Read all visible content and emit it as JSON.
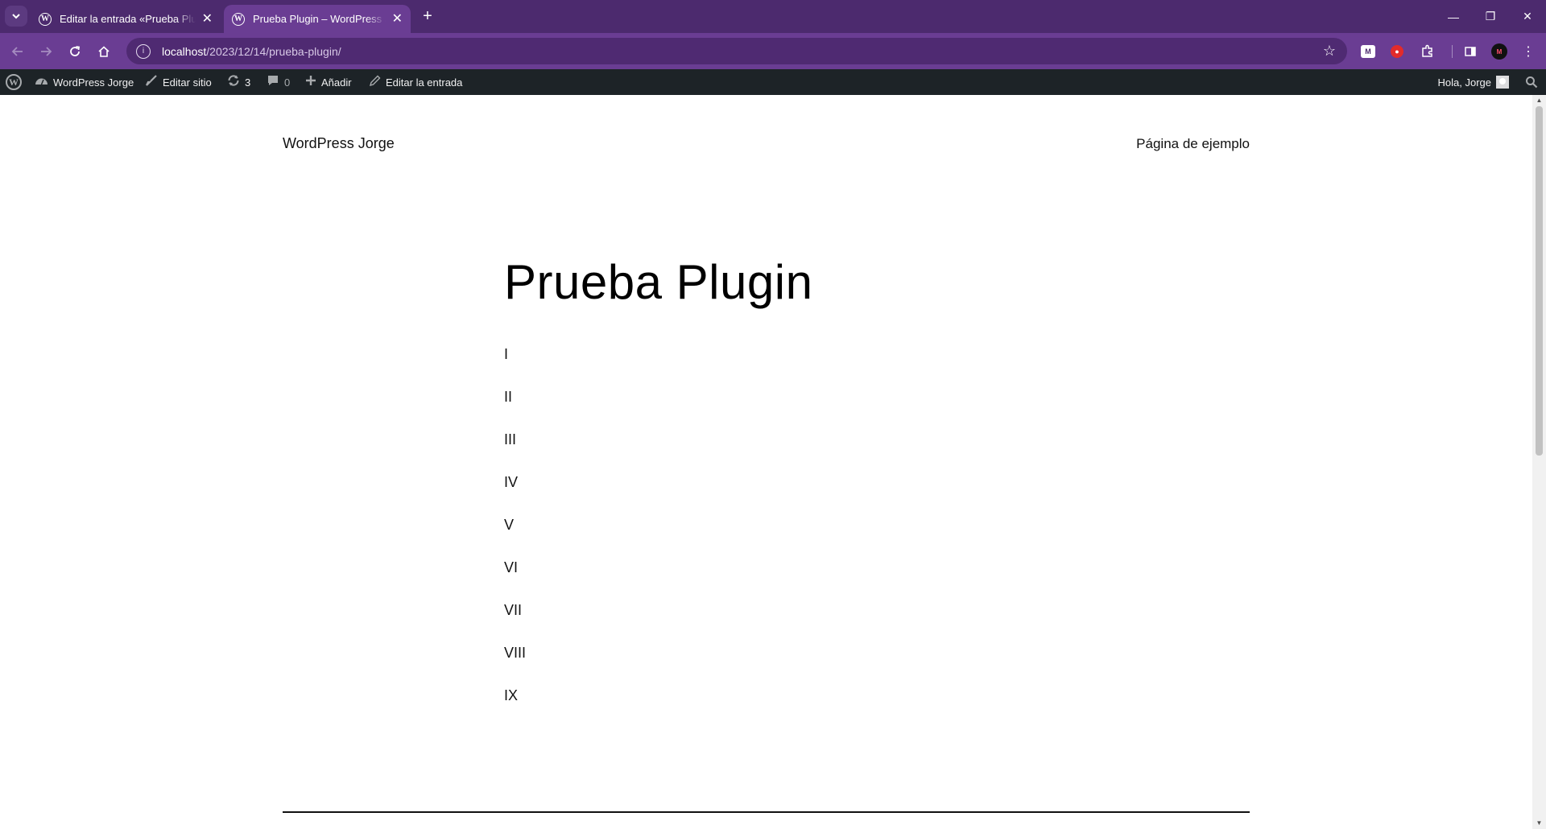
{
  "browser": {
    "tabs": [
      {
        "title": "Editar la entrada «Prueba Plugin",
        "active": false
      },
      {
        "title": "Prueba Plugin – WordPress Jorge",
        "active": true
      }
    ],
    "url_host": "localhost",
    "url_path": "/2023/12/14/prueba-plugin/",
    "theme_colors": {
      "tabstrip": "#4c2a6e",
      "toolbar": "#6a3d93",
      "omnibox": "#4f2a72"
    }
  },
  "adminbar": {
    "site_name": "WordPress Jorge",
    "edit_site": "Editar sitio",
    "updates_count": "3",
    "comments_count": "0",
    "add_new": "Añadir",
    "edit_post": "Editar la entrada",
    "greeting": "Hola, Jorge"
  },
  "site": {
    "title": "WordPress Jorge",
    "nav_item": "Página de ejemplo"
  },
  "post": {
    "title": "Prueba Plugin",
    "items": [
      "I",
      "II",
      "III",
      "IV",
      "V",
      "VI",
      "VII",
      "VIII",
      "IX"
    ]
  }
}
